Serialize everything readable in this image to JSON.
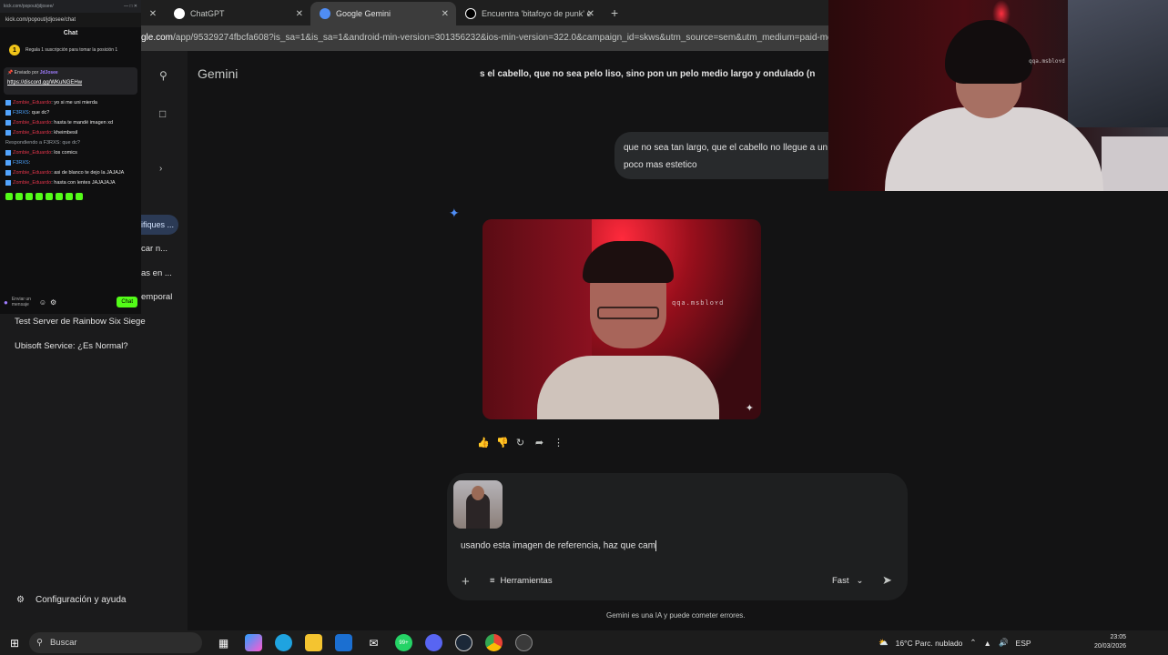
{
  "browser": {
    "tabs": [
      {
        "label": "ChatGPT"
      },
      {
        "label": "Google Gemini"
      },
      {
        "label": "Encuentra 'bitafoyo de punk' en"
      }
    ],
    "new_tab": "+",
    "close": "✕",
    "url_host": "gle.com",
    "url_path": "/app/95329274fbcfa608?is_sa=1&is_sa=1&android-min-version=301356232&ios-min-version=322.0&campaign_id=skws&utm_source=sem&utm_medium=paid-media&utm_c"
  },
  "kick": {
    "window_url": "kick.com/popout/jdjosee/",
    "url": "kick.com/popout/jdjosee/chat",
    "title": "Chat",
    "goal_coin": "1",
    "goal_text": "Regala 1 suscripción para tomar la posición 1",
    "pinned_by_prefix": "Enviado por",
    "pinned_by_user": "JdJosee",
    "pinned_link": "https://discord.gg/WKuNGEHw",
    "messages": [
      {
        "user": "Zombie_Eduardo",
        "text": ": yo si me uni mierda",
        "color": "red"
      },
      {
        "user": "F3RXS",
        "text": ": que dc?",
        "color": "blue"
      },
      {
        "user": "Zombie_Eduardo",
        "text": ": hasta te mandé imagen xd",
        "color": "red"
      },
      {
        "user": "Zombie_Eduardo",
        "text": ": kheimbesil",
        "color": "red"
      },
      {
        "user": "",
        "text": "Respondiendo a F3RXS: que dc?",
        "color": "reply"
      },
      {
        "user": "Zombie_Eduardo",
        "text": ": los comics",
        "color": "red"
      },
      {
        "user": "F3RXS",
        "text": ":",
        "color": "blue"
      },
      {
        "user": "Zombie_Eduardo",
        "text": ": asi de blanco te dejo la JAJAJA",
        "color": "red"
      },
      {
        "user": "Zombie_Eduardo",
        "text": ": hasta con lentes JAJAJAJA",
        "color": "red"
      }
    ],
    "input_placeholder": "Enviar un mensaje",
    "chat_button": "Chat"
  },
  "sidebar": {
    "items": [
      {
        "label": "ifiques ..."
      },
      {
        "label": "car n..."
      },
      {
        "label": "as en ..."
      },
      {
        "label": "emporal"
      },
      {
        "label": "Test Server de Rainbow Six Siege"
      },
      {
        "label": "Ubisoft Service: ¿Es Normal?"
      }
    ],
    "settings": "Configuración y ayuda"
  },
  "main": {
    "title": "Gemini",
    "previous_prompt_tail": "s el cabello, que no sea pelo liso, sino pon un pelo medio largo y ondulado (n",
    "user_message": "que no sea tan largo, que el cabello no llegue a un poco mas estetico",
    "image_overlay_text": "qqa.msbloʏd",
    "composer_text": "usando esta imagen de referencia, haz que cam",
    "tools_label": "Herramientas",
    "mode_label": "Fast",
    "disclaimer": "Gemini es una IA y puede cometer errores."
  },
  "webcam": {
    "overlay_text": "qqa.msbloʏd"
  },
  "taskbar": {
    "search_label": "Buscar",
    "weather": "16°C  Parc. nublado",
    "lang": "ESP",
    "time": "23:05",
    "date": "20/03/2026",
    "badge": "99+"
  }
}
